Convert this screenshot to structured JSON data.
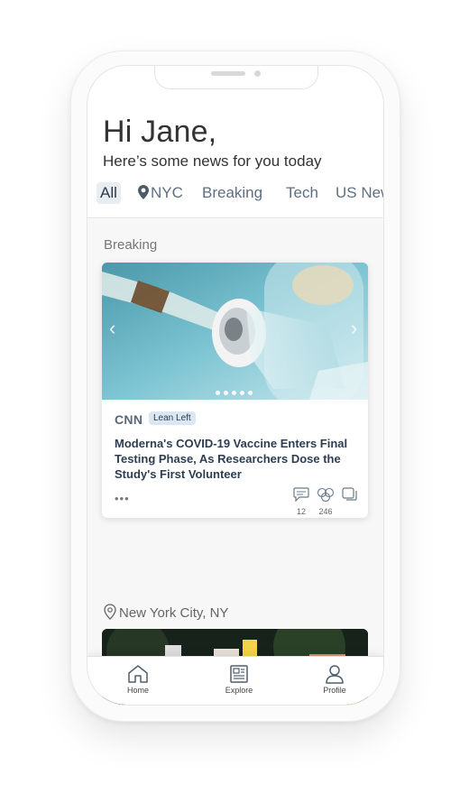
{
  "greeting": "Hi Jane,",
  "subtitle": "Here’s some news for you today",
  "tabs": [
    {
      "label": "All",
      "active": true
    },
    {
      "label": "NYC",
      "icon": "location-pin-icon"
    },
    {
      "label": "Breaking"
    },
    {
      "label": "Tech"
    },
    {
      "label": "US New"
    }
  ],
  "breaking": {
    "section_title": "Breaking",
    "card": {
      "source": "CNN",
      "bias": "Lean Left",
      "headline": "Moderna's COVID-19 Vaccine Enters Final Testing Phase, As Researchers Dose the Study's First Volunteer",
      "more": "•••",
      "comments": "12",
      "reactions": "246",
      "carousel_dots": 5
    }
  },
  "location_section": {
    "title": "New York City, NY",
    "icon": "location-pin-icon"
  },
  "nav": {
    "home": "Home",
    "explore": "Explore",
    "profile": "Profile"
  },
  "colors": {
    "accent": "#5f6f80",
    "badge_bg": "#dbe6f3",
    "headline": "#2e3d52"
  }
}
